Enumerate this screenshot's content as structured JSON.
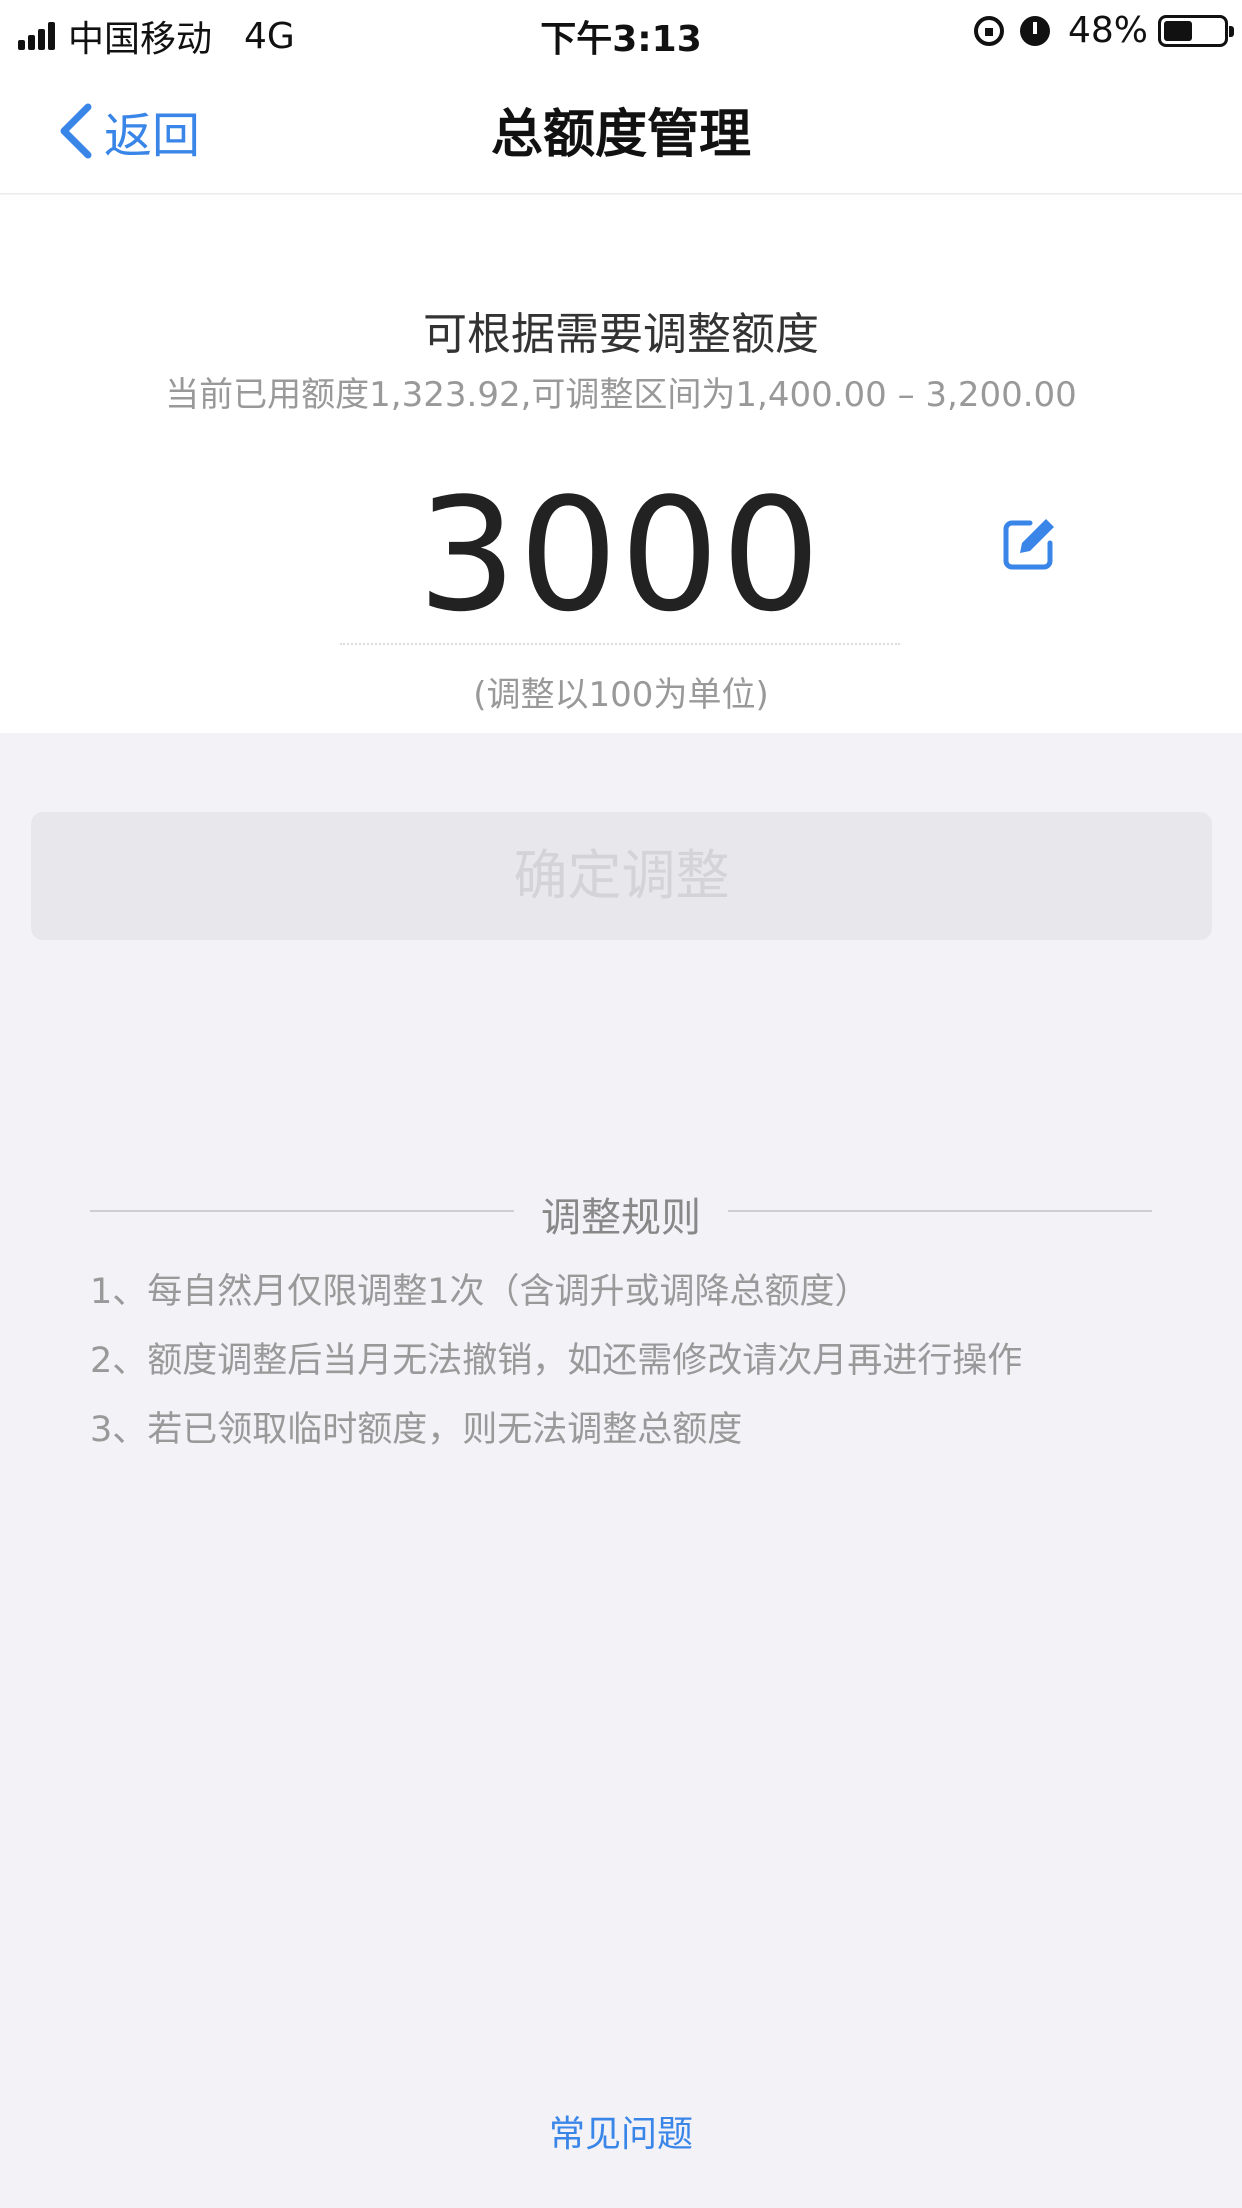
{
  "status_bar": {
    "carrier": "中国移动",
    "network": "4G",
    "time": "下午3:13",
    "battery": "48%",
    "battery_level": 0.48
  },
  "nav": {
    "back_label": "返回",
    "title": "总额度管理"
  },
  "adjust": {
    "headline": "可根据需要调整额度",
    "info": "当前已用额度1,323.92,可调整区间为1,400.00 – 3,200.00",
    "amount": "3000",
    "unit_note": "(调整以100为单位)"
  },
  "confirm_button": "确定调整",
  "rules": {
    "title": "调整规则",
    "items": [
      "1、每自然月仅限调整1次（含调升或调降总额度）",
      "2、额度调整后当月无法撤销，如还需修改请次月再进行操作",
      "3、若已领取临时额度，则无法调整总额度"
    ]
  },
  "faq_link": "常见问题",
  "colors": {
    "accent": "#3a86e8",
    "background": "#f2f2f7"
  }
}
